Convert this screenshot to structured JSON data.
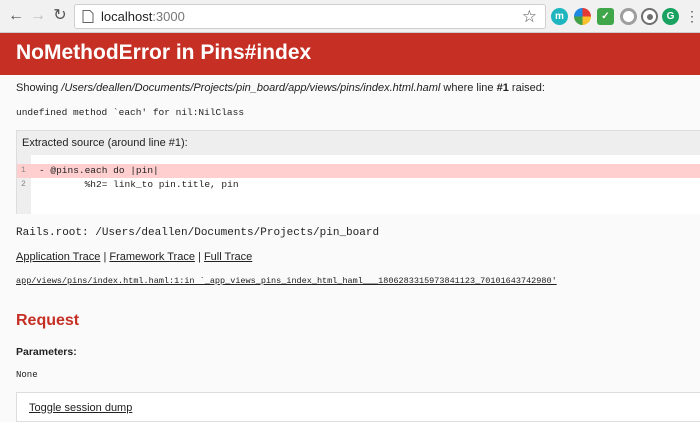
{
  "browser": {
    "url_host": "localhost",
    "url_port": ":3000",
    "extensions": [
      {
        "name": "m",
        "color": "#1fb5bf"
      },
      {
        "name": "",
        "color": "#e57e2c"
      },
      {
        "name": "",
        "color": "#3fa64a"
      },
      {
        "name": "",
        "color": "#9e9e9e"
      },
      {
        "name": "",
        "color": "#6f6f6f"
      },
      {
        "name": "G",
        "color": "#1aa260"
      }
    ]
  },
  "error": {
    "title": "NoMethodError in Pins#index",
    "showing_prefix": "Showing ",
    "showing_path": "/Users/deallen/Documents/Projects/pin_board/app/views/pins/index.html.haml",
    "showing_mid": " where line ",
    "showing_line": "#1",
    "showing_suffix": " raised:",
    "message": "undefined method `each' for nil:NilClass"
  },
  "source": {
    "header": "Extracted source (around line #1):",
    "lines": [
      {
        "num": "1",
        "code": "- @pins.each do |pin|"
      },
      {
        "num": "2",
        "code": "\t%h2= link_to pin.title, pin"
      }
    ]
  },
  "rails_root": "Rails.root: /Users/deallen/Documents/Projects/pin_board",
  "traces": {
    "application": "Application Trace",
    "framework": "Framework Trace",
    "full": "Full Trace",
    "sep": " | ",
    "line": "app/views/pins/index.html.haml:1:in `_app_views_pins_index_html_haml___1806283315973841123_70101643742980'"
  },
  "request": {
    "title": "Request",
    "params_label": "Parameters:",
    "params_value": "None",
    "toggle": "Toggle session dump"
  }
}
